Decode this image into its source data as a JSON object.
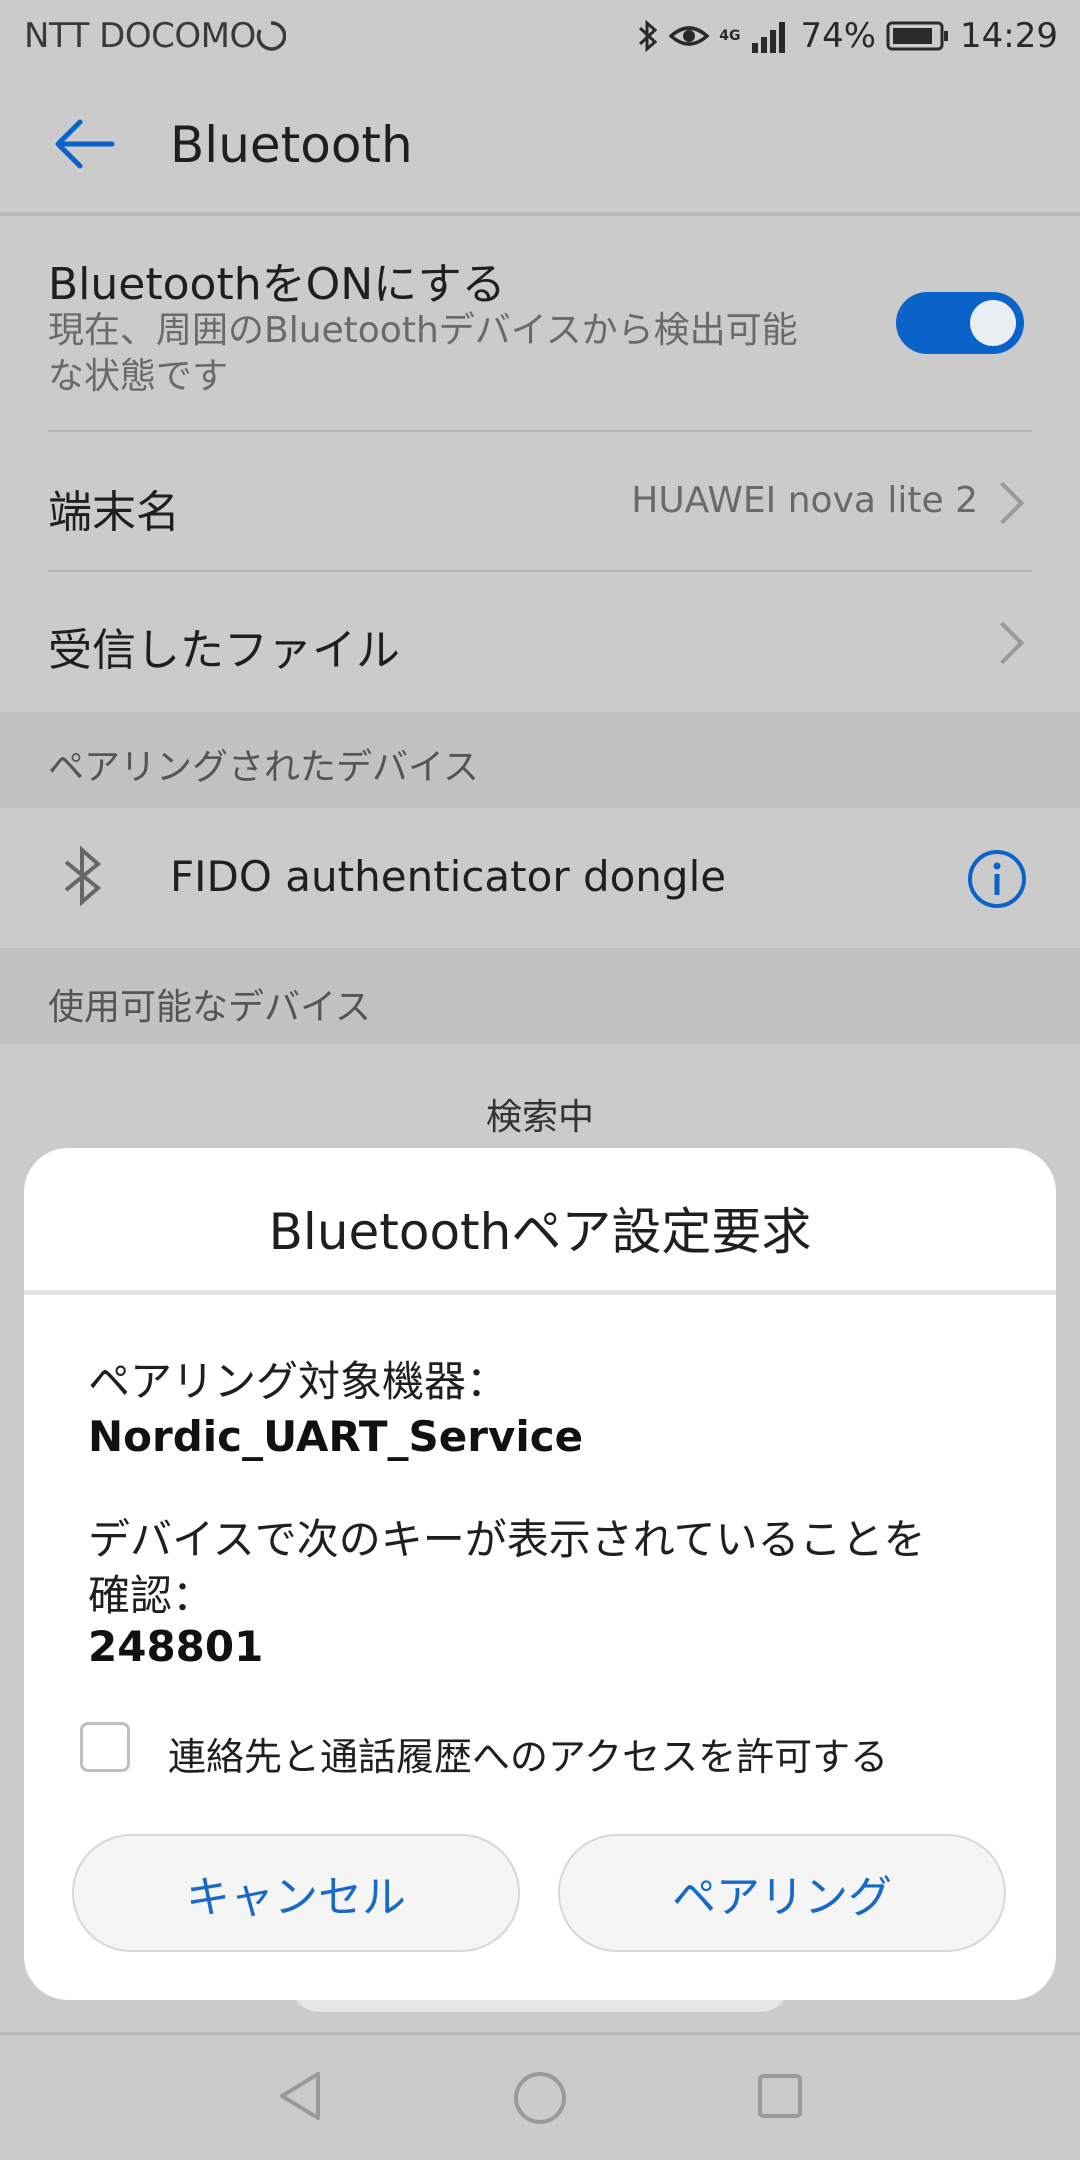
{
  "status_bar": {
    "carrier": "NTT DOCOMO",
    "battery": "74%",
    "time": "14:29",
    "network": "4G"
  },
  "header": {
    "title": "Bluetooth"
  },
  "bluetooth_toggle": {
    "label": "BluetoothをONにする",
    "description_line1": "現在、周囲のBluetoothデバイスから検出可能",
    "description_line2": "な状態です",
    "state": "on"
  },
  "device_name": {
    "label": "端末名",
    "value": "HUAWEI nova lite 2"
  },
  "received_files": {
    "label": "受信したファイル"
  },
  "paired_section": {
    "label": "ペアリングされたデバイス",
    "devices": [
      {
        "name": "FIDO authenticator dongle"
      }
    ]
  },
  "available_section": {
    "label": "使用可能なデバイス",
    "status": "検索中"
  },
  "dialog": {
    "title": "Bluetoothペア設定要求",
    "target_label": "ペアリング対象機器：",
    "target_device": "Nordic_UART_Service",
    "confirm_line1": "デバイスで次のキーが表示されていることを",
    "confirm_line2": "確認：",
    "passkey": "248801",
    "checkbox_label": "連絡先と通話履歴へのアクセスを許可する",
    "cancel_label": "キャンセル",
    "pair_label": "ペアリング"
  },
  "colors": {
    "accent": "#0a63c9",
    "button_text": "#1869c8",
    "overlay_bg": "#cccccc"
  }
}
